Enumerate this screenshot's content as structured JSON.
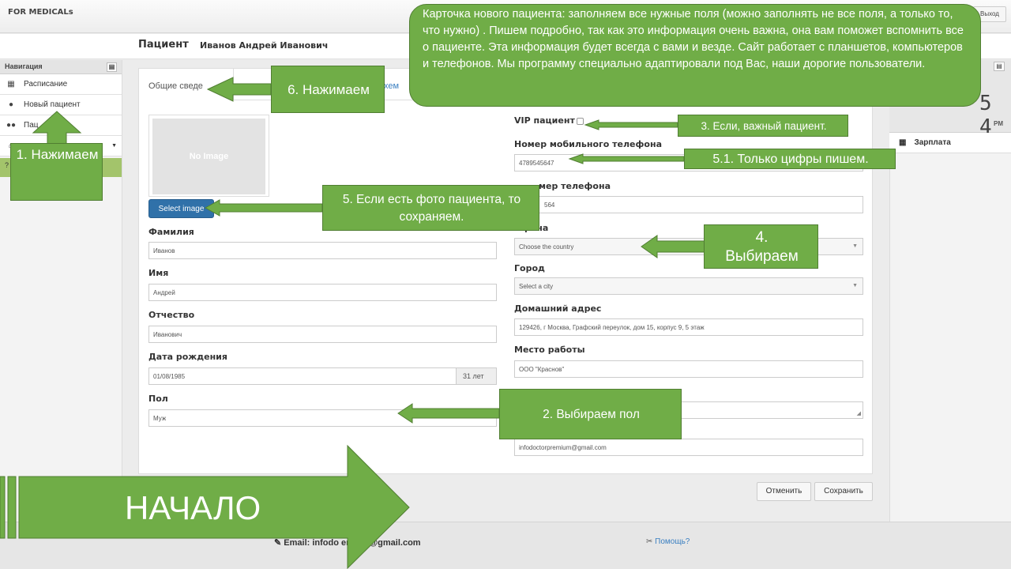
{
  "app": {
    "brand": "FOR MEDICALs",
    "logout": "Выход"
  },
  "header": {
    "label": "Пациент",
    "patient_name": "Иванов Андрей Иванович"
  },
  "sidebar": {
    "title": "Навигация",
    "items": [
      {
        "label": "Расписание",
        "icon": "calendar-icon"
      },
      {
        "label": "Новый пациент",
        "icon": "user-icon"
      },
      {
        "label": "Пац",
        "icon": "users-icon"
      }
    ]
  },
  "tabs": {
    "general": "Общие сведе",
    "scheme": "Схем"
  },
  "photo": {
    "placeholder": "No Image",
    "button": "Select image"
  },
  "form_left": {
    "surname_label": "Фамилия",
    "surname": "Иванов",
    "name_label": "Имя",
    "name": "Андрей",
    "patronymic_label": "Отчество",
    "patronymic": "Иванович",
    "dob_label": "Дата рождения",
    "dob": "01/08/1985",
    "age": "31 лет",
    "sex_label": "Пол",
    "sex": "Муж"
  },
  "form_right": {
    "vip_label": "VIP пациент",
    "mobile_label": "Номер мобильного телефона",
    "mobile": "4789545647",
    "phone_label": "мер телефона",
    "phone": "564",
    "country_label": "рана",
    "country": "Choose the country",
    "city_label": "Город",
    "city": "Select a city",
    "address_label": "Домашний адрес",
    "address": "129426, г Москва, Графский переулок, дом 15, корпус 9, 5 этаж",
    "work_label": "Место работы",
    "work": "ООО \"Краснов\"",
    "email": "infodoctorpremium@gmail.com"
  },
  "actions": {
    "cancel": "Отменить",
    "save": "Сохранить"
  },
  "right_panel": {
    "clock": "5 4",
    "ampm": "PM",
    "salary": "Зарплата"
  },
  "footer": {
    "email": "Email:  infodo         emium@gmail.com",
    "help": "Помощь?"
  },
  "annotations": {
    "callout": "Карточка нового пациента: заполняем все нужные поля (можно заполнять не все поля, а только то, что нужно) . Пишем подробно, так как это информация очень важна, она вам поможет вспомнить все о пациенте. Эта информация будет всегда с вами и везде. Сайт работает с планшетов, компьютеров и телефонов. Мы программу специально адаптировали под Вас, наши дорогие пользователи.",
    "a1": "1. Нажимаем",
    "a6": "6. Нажимаем",
    "a3": "3. Если, важный пациент.",
    "a51": "5.1. Только цифры пишем.",
    "a5": "5. Если есть фото пациента, то сохраняем.",
    "a4": "4. Выбираем",
    "a2": "2. Выбираем пол",
    "start": "НАЧАЛО"
  },
  "colors": {
    "annotation_green": "#70ad47",
    "primary_blue": "#3071a9"
  }
}
